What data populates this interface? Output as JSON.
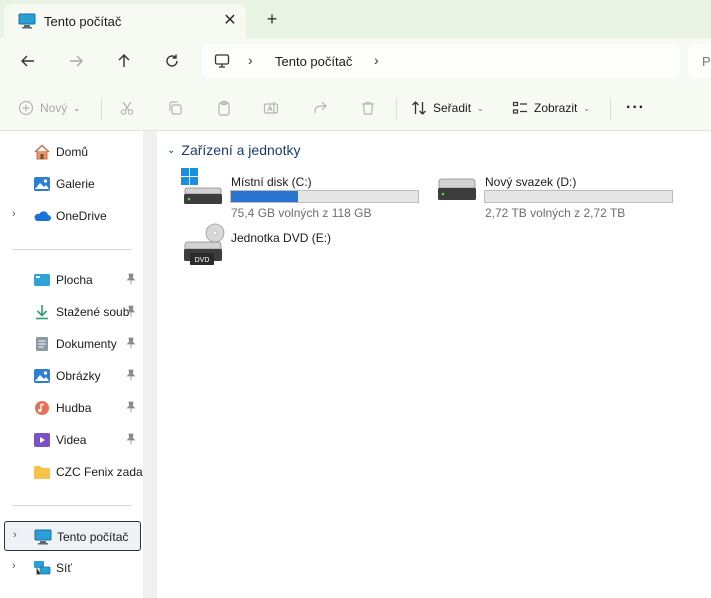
{
  "window": {
    "tab_title": "Tento počítač",
    "close_glyph": "✕",
    "new_tab_glyph": "+"
  },
  "address_bar": {
    "separator": "›",
    "location": "Tento počítač",
    "search_placeholder_fragment": "P"
  },
  "command_bar": {
    "new_label": "Nový",
    "sort_label": "Seřadit",
    "view_label": "Zobrazit",
    "more_glyph": "···",
    "caret": "⌄"
  },
  "sidebar": {
    "items": [
      {
        "label": "Domů",
        "icon": "home-icon",
        "expandable": false,
        "pinned": false
      },
      {
        "label": "Galerie",
        "icon": "gallery-icon",
        "expandable": false,
        "pinned": false
      },
      {
        "label": "OneDrive",
        "icon": "onedrive-icon",
        "expandable": true,
        "pinned": false
      },
      {
        "label": "Plocha",
        "icon": "desktop-icon",
        "expandable": false,
        "pinned": true
      },
      {
        "label": "Stažené soub",
        "icon": "downloads-icon",
        "expandable": false,
        "pinned": true
      },
      {
        "label": "Dokumenty",
        "icon": "documents-icon",
        "expandable": false,
        "pinned": true
      },
      {
        "label": "Obrázky",
        "icon": "pictures-icon",
        "expandable": false,
        "pinned": true
      },
      {
        "label": "Hudba",
        "icon": "music-icon",
        "expandable": false,
        "pinned": true
      },
      {
        "label": "Videa",
        "icon": "videos-icon",
        "expandable": false,
        "pinned": true
      },
      {
        "label": "CZC Fenix zadat",
        "icon": "folder-icon",
        "expandable": false,
        "pinned": false
      },
      {
        "label": "Tento počítač",
        "icon": "this-pc-icon",
        "expandable": true,
        "pinned": false,
        "selected": true
      },
      {
        "label": "Síť",
        "icon": "network-icon",
        "expandable": true,
        "pinned": false
      }
    ],
    "chevron": "›"
  },
  "content": {
    "group_title": "Zařízení a jednotky",
    "group_chevron": "⌄",
    "drives": [
      {
        "name": "Místní disk (C:)",
        "free_text": "75,4 GB volných z 118 GB",
        "used_fraction": 0.36,
        "icon": "windows-drive-icon"
      },
      {
        "name": "Nový svazek (D:)",
        "free_text": "2,72 TB volných z 2,72 TB",
        "used_fraction": 0.0,
        "icon": "hard-drive-icon"
      },
      {
        "name": "Jednotka DVD (E:)",
        "free_text": "",
        "icon": "dvd-drive-icon",
        "badge": "DVD"
      }
    ]
  },
  "colors": {
    "accent": "#2775d1",
    "group_header": "#1e3a6e",
    "chrome": "#f6faf3"
  }
}
